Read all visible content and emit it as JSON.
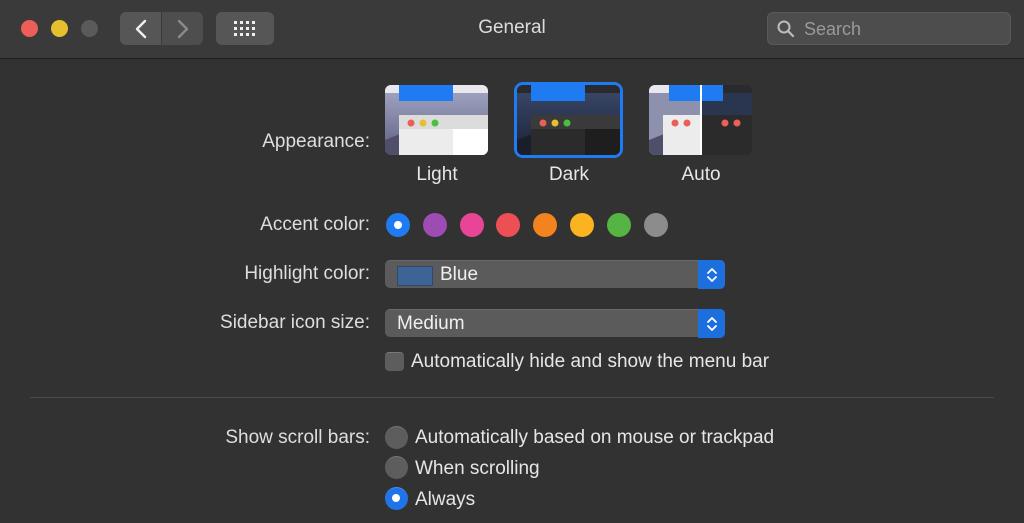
{
  "window": {
    "title": "General",
    "search_placeholder": "Search"
  },
  "appearance": {
    "label": "Appearance:",
    "options": [
      "Light",
      "Dark",
      "Auto"
    ],
    "selected": "Dark"
  },
  "accent": {
    "label": "Accent color:",
    "colors": [
      "#1f7bf2",
      "#9d4cb3",
      "#e84597",
      "#ec5055",
      "#f2831e",
      "#fbb31f",
      "#55b443",
      "#8c8c8c"
    ],
    "selected": 0
  },
  "highlight": {
    "label": "Highlight color:",
    "value": "Blue",
    "chip_color": "#3d6494"
  },
  "sidebar": {
    "label": "Sidebar icon size:",
    "value": "Medium"
  },
  "menubar": {
    "label": "Automatically hide and show the menu bar",
    "checked": false
  },
  "scrollbars": {
    "label": "Show scroll bars:",
    "options": [
      "Automatically based on mouse or trackpad",
      "When scrolling",
      "Always"
    ],
    "selected": "Always"
  }
}
